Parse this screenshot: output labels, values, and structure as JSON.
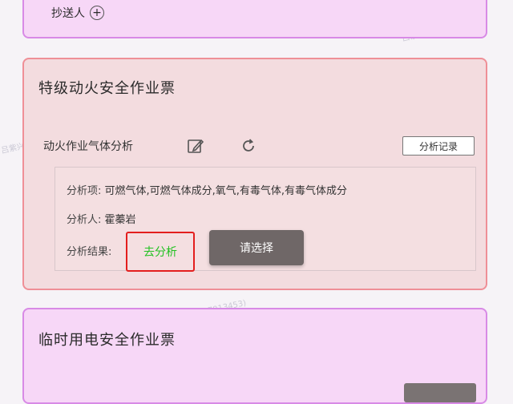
{
  "top_card": {
    "copy_label": "抄送人",
    "add_icon": "plus-circle-icon"
  },
  "fire_card": {
    "title": "特级动火安全作业票",
    "gas_label": "动火作业气体分析",
    "edit_icon": "edit-icon",
    "refresh_icon": "refresh-icon",
    "record_button": "分析记录",
    "analysis_items_label": "分析项:",
    "analysis_items_value": "可燃气体,可燃气体成分,氧气,有毒气体,有毒气体成分",
    "analyst_label": "分析人:",
    "analyst_value": "霍蓁岩",
    "result_label": "分析结果:",
    "go_analyze": "去分析",
    "choose_button": "请选择"
  },
  "power_card": {
    "title": "临时用电安全作业票"
  },
  "watermark": "吕紫兴(18817913453)",
  "colors": {
    "fire_bg": "#f3dcdf",
    "fire_border": "#ef8f97",
    "power_bg": "#f7d7f7",
    "power_border": "#d88ae6",
    "highlight": "#e31e1e",
    "link_green": "#22c122"
  }
}
